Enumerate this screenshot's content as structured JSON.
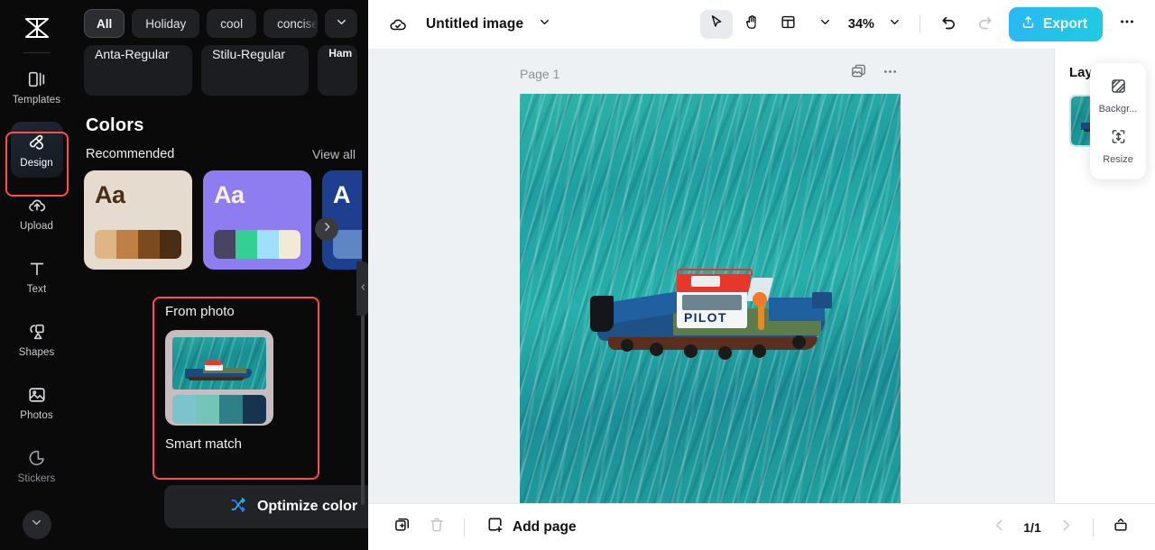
{
  "app": {
    "brand_icon": "capcut-logo-icon"
  },
  "rail": {
    "items": [
      {
        "label": "Templates",
        "icon": "templates-icon",
        "active": false
      },
      {
        "label": "Design",
        "icon": "design-icon",
        "active": true
      },
      {
        "label": "Upload",
        "icon": "upload-cloud-icon",
        "active": false
      },
      {
        "label": "Text",
        "icon": "text-icon",
        "active": false
      },
      {
        "label": "Shapes",
        "icon": "shapes-icon",
        "active": false
      },
      {
        "label": "Photos",
        "icon": "photos-icon",
        "active": false
      },
      {
        "label": "Stickers",
        "icon": "stickers-icon",
        "active": false
      }
    ],
    "more_icon": "chevron-down-icon"
  },
  "panel": {
    "chips": [
      {
        "label": "All",
        "selected": true
      },
      {
        "label": "Holiday",
        "selected": false
      },
      {
        "label": "cool",
        "selected": false
      },
      {
        "label": "concise",
        "selected": false
      }
    ],
    "chips_expand_icon": "chevron-down-icon",
    "fonts": [
      {
        "name": "Anta-Regular"
      },
      {
        "name": "Stilu-Regular"
      },
      {
        "name": "Ham"
      }
    ],
    "colors_heading": "Colors",
    "recommended_label": "Recommended",
    "view_all_label": "View all",
    "next_arrow_icon": "chevron-right-icon",
    "palettes": [
      {
        "bg": "#e6dbcf",
        "aa": "Aa",
        "aa_color": "#4a2e18",
        "swatches": [
          "#dfb683",
          "#c08043",
          "#7b4a1e",
          "#4b2c14"
        ]
      },
      {
        "bg": "#8d7df0",
        "aa": "Aa",
        "aa_color": "#f6f0dc",
        "swatches": [
          "#494560",
          "#35cf92",
          "#9fdffb",
          "#f0ead6"
        ]
      },
      {
        "bg": "#1e3f8f",
        "aa": "A",
        "aa_color": "#ffffff",
        "swatches": [
          "#5e86c4",
          "#5e86c4",
          "#5e86c4",
          "#5e86c4"
        ]
      }
    ],
    "from_photo_label": "From photo",
    "smart_match_label": "Smart match",
    "smart_match_swatches": [
      "#7cc3cd",
      "#74c4b8",
      "#2e8086",
      "#17334e"
    ],
    "smart_match_card_bg": "#c8bcbf",
    "optimize_button": {
      "label": "Optimize color",
      "icon": "shuffle-icon"
    },
    "scrollbar": "panel-scrollbar",
    "collapse_icon": "chevron-left-icon"
  },
  "topbar": {
    "cloud_icon": "cloud-saved-icon",
    "doc_title": "Untitled image",
    "title_caret_icon": "chevron-down-icon",
    "tools": [
      {
        "name": "select-tool",
        "icon": "cursor-arrow-icon",
        "active": true
      },
      {
        "name": "hand-tool",
        "icon": "hand-icon",
        "active": false
      },
      {
        "name": "layout-tool",
        "icon": "layout-grid-icon",
        "active": false
      }
    ],
    "layout_caret_icon": "chevron-down-icon",
    "zoom_level": "34%",
    "zoom_caret_icon": "chevron-down-icon",
    "undo_icon": "undo-icon",
    "redo_icon": "redo-icon",
    "export": {
      "label": "Export",
      "icon": "export-upload-icon",
      "color": "#29bce8"
    },
    "more_icon": "more-horizontal-icon"
  },
  "canvas": {
    "page_label": "Page 1",
    "duplicate_page_icon": "duplicate-image-icon",
    "page_more_icon": "more-horizontal-icon",
    "artboard_alt": "aerial photo of blue and red PILOT tugboat on turquoise sea",
    "boat_name": "PILOT"
  },
  "float_panel": {
    "items": [
      {
        "label": "Backgr...",
        "icon": "background-icon"
      },
      {
        "label": "Resize",
        "icon": "resize-icon"
      }
    ]
  },
  "layers": {
    "title": "Layers",
    "items": [
      {
        "name": "image-layer-thumbnail",
        "badge_icon": "background-icon"
      }
    ]
  },
  "bottombar": {
    "duplicate_icon": "duplicate-page-icon",
    "delete_icon": "trash-icon",
    "add_page": {
      "label": "Add page",
      "icon": "add-page-icon"
    },
    "prev_icon": "chevron-left-icon",
    "page_indicator": "1/1",
    "next_icon": "chevron-right-icon",
    "present_icon": "present-icon"
  }
}
